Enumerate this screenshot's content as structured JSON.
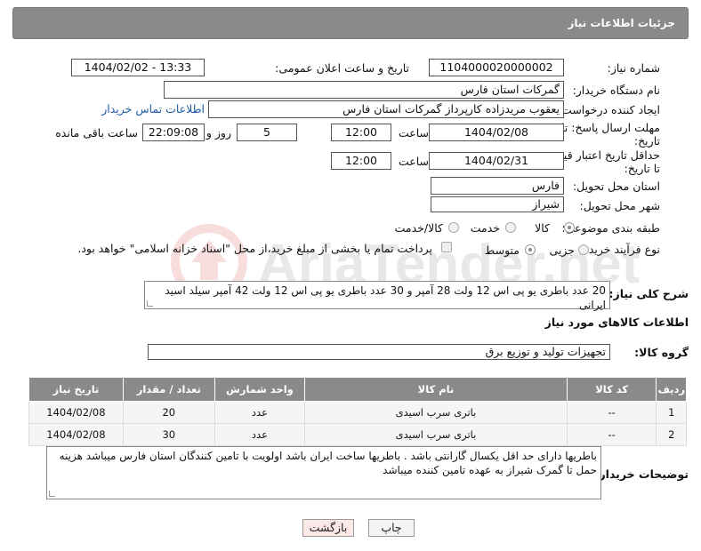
{
  "header": {
    "title": "جزئیات اطلاعات نیاز"
  },
  "fields": {
    "need_number": {
      "label": "شماره نیاز:",
      "value": "1104000020000002"
    },
    "announce_datetime": {
      "label": "تاریخ و ساعت اعلان عمومی:",
      "value": "1404/02/02 - 13:33"
    },
    "buyer_org": {
      "label": "نام دستگاه خریدار:",
      "value": "گمرکات استان فارس"
    },
    "requester": {
      "label": "ایجاد کننده درخواست:",
      "value": "یعقوب مریدزاده کارپرداز گمرکات استان فارس"
    },
    "buyer_contact_link": "اطلاعات تماس خریدار",
    "deadline": {
      "label_line1": "مهلت ارسال پاسخ: تا",
      "label_line2": "تاریخ:",
      "date": "1404/02/08",
      "time_label": "ساعت",
      "time": "12:00",
      "days": "5",
      "days_label": "روز و",
      "remaining": "22:09:08",
      "remaining_label": "ساعت باقی مانده"
    },
    "price_validity": {
      "label_line1": "حداقل تاریخ اعتبار قیمت:",
      "label_line2": "تا تاریخ:",
      "date": "1404/02/31",
      "time_label": "ساعت",
      "time": "12:00"
    },
    "delivery_province": {
      "label": "استان محل تحویل:",
      "value": "فارس"
    },
    "delivery_city": {
      "label": "شهر محل تحویل:",
      "value": "شیراز"
    },
    "subject_category": {
      "label": "طبقه بندی موضوعی:",
      "options": [
        "کالا",
        "خدمت",
        "کالا/خدمت"
      ],
      "selected": "کالا"
    },
    "purchase_type": {
      "label": "نوع فرآیند خرید :",
      "options": [
        "جزیی",
        "متوسط"
      ],
      "selected": "متوسط",
      "payment_note": "پرداخت تمام یا بخشی از مبلغ خرید،از محل \"اسناد خزانه اسلامی\" خواهد بود."
    }
  },
  "description": {
    "label": "شرح کلی نیاز:",
    "value": "20 عدد باطری یو پی اس 12 ولت 28 آمپر و 30 عدد باطری یو پی اس 12 ولت 42 آمپر سیلد اسید ایرانی"
  },
  "goods_section": {
    "title": "اطلاعات کالاهای مورد نیاز",
    "group_label": "گروه کالا:",
    "group_value": "تجهیزات تولید و توزیع برق"
  },
  "table": {
    "headers": [
      "ردیف",
      "کد کالا",
      "نام کالا",
      "واحد شمارش",
      "تعداد / مقدار",
      "تاریخ نیاز"
    ],
    "rows": [
      [
        "1",
        "--",
        "باتری سرب اسیدی",
        "عدد",
        "20",
        "1404/02/08"
      ],
      [
        "2",
        "--",
        "باتری سرب اسیدی",
        "عدد",
        "30",
        "1404/02/08"
      ]
    ]
  },
  "buyer_notes": {
    "label": "توضیحات خریدار:",
    "value": "باطریها دارای حد اقل یکسال گارانتی باشد  . باطریها ساخت ایران باشد اولویت با تامین کنندگان استان فارس میباشد هزینه حمل تا گمرک شیراز به عهده تامین کننده میباشد"
  },
  "buttons": {
    "print": "چاپ",
    "back": "بازگشت"
  },
  "colors": {
    "header_bg": "#8a8a8a",
    "link": "#1e5aa8",
    "back_button_bg": "#fde8e8"
  }
}
